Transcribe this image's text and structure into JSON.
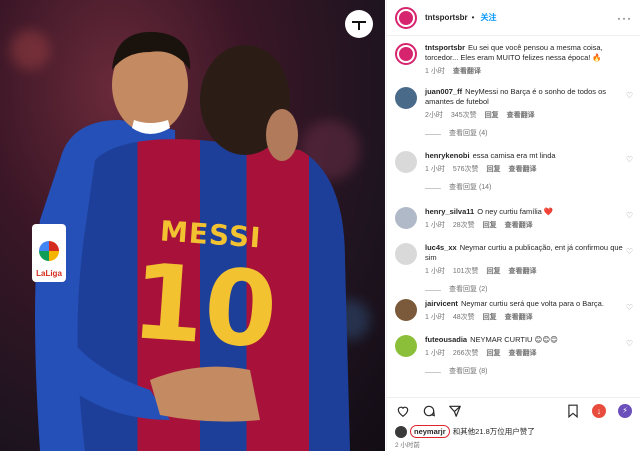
{
  "post": {
    "account": "tntsportsbr",
    "follow_label": "关注",
    "more_label": "···",
    "jersey_name": "MESSI",
    "jersey_number": "10",
    "laliga_label": "LaLiga"
  },
  "caption": {
    "username": "tntsportsbr",
    "text": "Eu sei que você pensou a mesma coisa, torcedor... Eles eram MUITO felizes nessa época! 🔥",
    "time": "1 小时",
    "translate": "查看翻译"
  },
  "comments": [
    {
      "username": "juan007_ff",
      "text": "NeyMessi no Barça é o sonho de todos os amantes de futebol",
      "time": "2小时",
      "likes": "345次赞",
      "reply": "回复",
      "translate": "查看翻译",
      "replies": "查看回复 (4)"
    },
    {
      "username": "henrykenobi",
      "text": "essa camisa era mt linda",
      "time": "1 小时",
      "likes": "576次赞",
      "reply": "回复",
      "translate": "查看翻译",
      "replies": "查看回复 (14)"
    },
    {
      "username": "henry_silva11",
      "text": "O ney curtiu família ❤️",
      "time": "1 小时",
      "likes": "28次赞",
      "reply": "回复",
      "translate": "查看翻译",
      "replies": ""
    },
    {
      "username": "luc4s_xx",
      "text": "Neymar curtiu a publicação, ent já confirmou que sim",
      "time": "1 小时",
      "likes": "101次赞",
      "reply": "回复",
      "translate": "查看翻译",
      "replies": "查看回复 (2)"
    },
    {
      "username": "jairvicent",
      "text": "Neymar curtiu será que volta para o Barça.",
      "time": "1 小时",
      "likes": "48次赞",
      "reply": "回复",
      "translate": "查看翻译",
      "replies": ""
    },
    {
      "username": "futeousadia",
      "text": "NEYMAR CURTIU 😊😊😊",
      "time": "1 小时",
      "likes": "266次赞",
      "reply": "回复",
      "translate": "查看翻译",
      "replies": "查看回复 (8)"
    }
  ],
  "likes_line": {
    "circled_user": "neymarjr",
    "rest": "和其他21.8万位用户赞了"
  },
  "post_time": "2 小时前",
  "colors": {
    "brand": "#d6246e",
    "link": "#0095f6",
    "highlight": "#e0232c"
  }
}
